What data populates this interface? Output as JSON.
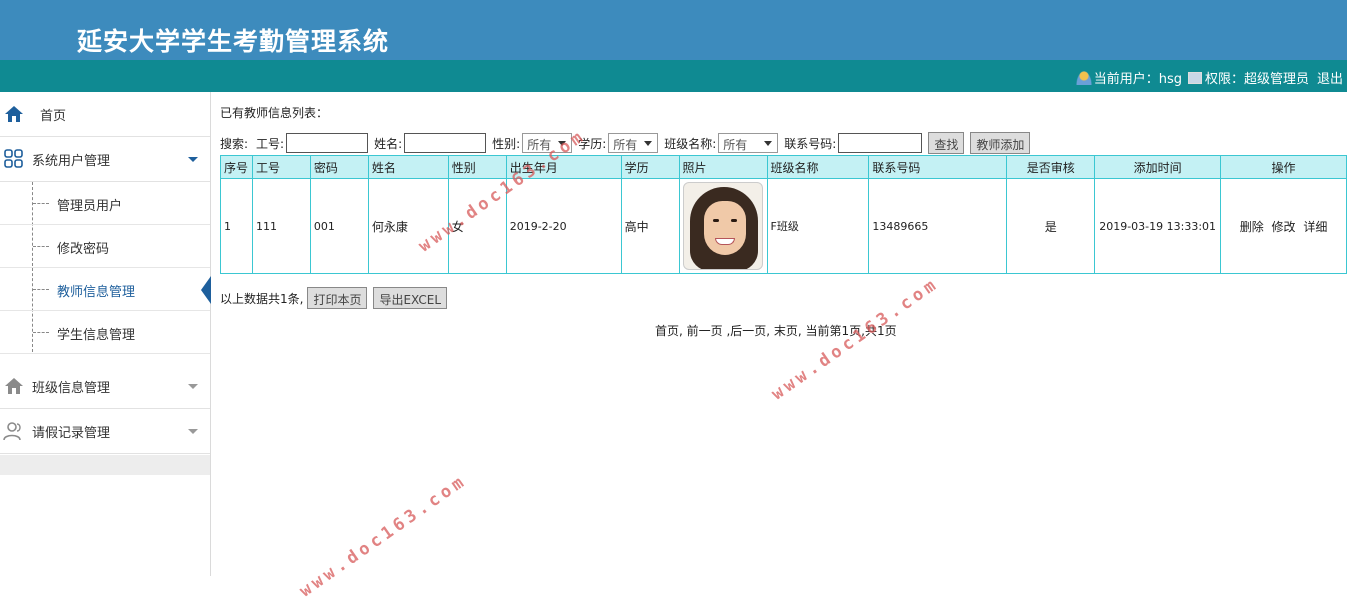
{
  "app": {
    "title": "延安大学学生考勤管理系统",
    "current_user_label": "当前用户：hsg",
    "permission_label": "权限：超级管理员",
    "logout_label": "退出"
  },
  "sidebar": {
    "home": "首页",
    "groups": [
      {
        "label": "系统用户管理",
        "icon": "grid-icon",
        "expanded": true,
        "items": [
          "管理员用户",
          "修改密码",
          "教师信息管理",
          "学生信息管理"
        ],
        "active_index": 2
      },
      {
        "label": "班级信息管理",
        "icon": "home-icon",
        "expanded": false
      },
      {
        "label": "请假记录管理",
        "icon": "users-icon",
        "expanded": false
      }
    ]
  },
  "main": {
    "list_title": "已有教师信息列表：",
    "search": {
      "prefix": "搜索:",
      "id_label": "工号:",
      "id_value": "",
      "name_label": "姓名:",
      "name_value": "",
      "gender_label": "性别:",
      "gender_value": "所有",
      "education_label": "学历:",
      "education_value": "所有",
      "class_label": "班级名称:",
      "class_value": "所有",
      "phone_label": "联系号码:",
      "phone_value": "",
      "search_button": "查找",
      "add_button": "教师添加"
    },
    "table": {
      "columns": [
        "序号",
        "工号",
        "密码",
        "姓名",
        "性别",
        "出生年月",
        "学历",
        "照片",
        "班级名称",
        "联系号码",
        "是否审核",
        "添加时间",
        "操作"
      ],
      "rows": [
        {
          "index": "1",
          "id": "111",
          "password": "001",
          "name": "何永康",
          "gender": "女",
          "birth": "2019-2-20",
          "education": "高中",
          "photo": "portrait",
          "class": "F班级",
          "phone": "13489665",
          "approved": "是",
          "added_time": "2019-03-19 13:33:01",
          "actions": [
            "删除",
            "修改",
            "详细"
          ]
        }
      ]
    },
    "summary": "以上数据共1条,",
    "print_button": "打印本页",
    "export_button": "导出EXCEL",
    "pager": "首页, 前一页 ,后一页, 末页, 当前第1页,共1页"
  },
  "watermarks": [
    "www.doc163.com",
    "www.doc163.com",
    "www.doc163.com"
  ],
  "colors": {
    "header": "#3d8bbd",
    "userbar": "#0f8a92",
    "table_header": "#c4f1f4",
    "table_border": "#3bc7d2",
    "active": "#1e5f9c"
  }
}
